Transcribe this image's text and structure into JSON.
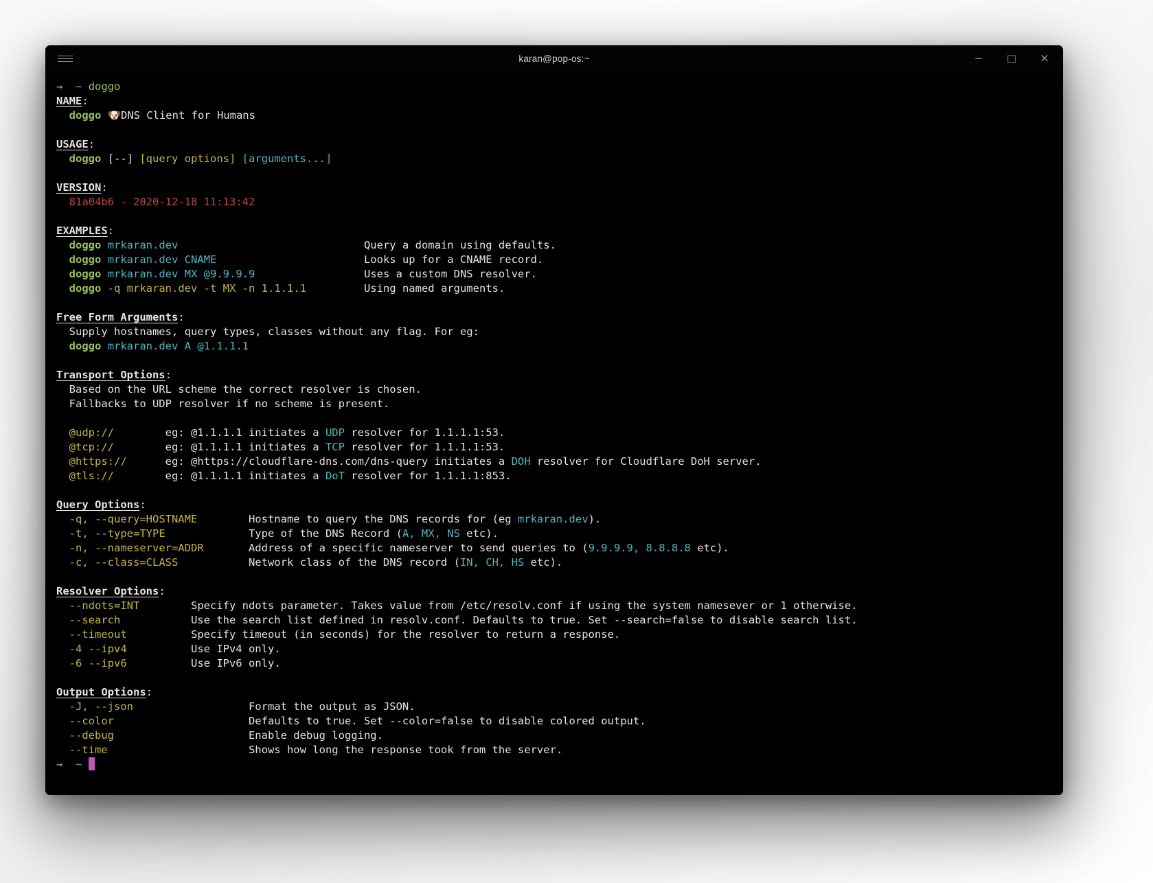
{
  "colors": {
    "page_bg": "#f3f3f3",
    "terminal_bg": "#000000",
    "fg": "#e6e3dd",
    "green": "#98c15e",
    "cyan": "#54b5c1",
    "yellow": "#c3b54a",
    "red": "#bc4b41",
    "magenta": "#c157b8",
    "title_fg": "#d2d0cc",
    "control_fg": "#919191"
  },
  "window": {
    "title": "karan@pop-os:~",
    "controls": {
      "minimize": "−",
      "maximize": "□",
      "close": "×"
    }
  },
  "terminal": {
    "lines": [
      {
        "s": [
          {
            "t": "→",
            "c": "green"
          },
          {
            "t": "  "
          },
          {
            "t": "~",
            "c": "cyan"
          },
          {
            "t": " "
          },
          {
            "t": "doggo",
            "c": "green"
          }
        ]
      },
      {
        "s": [
          {
            "t": "NAME",
            "b": 1,
            "u": 1
          },
          {
            "t": ":"
          }
        ]
      },
      {
        "s": [
          {
            "t": "  "
          },
          {
            "t": "doggo",
            "c": "green",
            "b": 1
          },
          {
            "t": " 🐶"
          },
          {
            "t": "DNS Client for Humans"
          }
        ]
      },
      {
        "s": []
      },
      {
        "s": [
          {
            "t": "USAGE",
            "b": 1,
            "u": 1
          },
          {
            "t": ":"
          }
        ]
      },
      {
        "s": [
          {
            "t": "  "
          },
          {
            "t": "doggo",
            "c": "green",
            "b": 1
          },
          {
            "t": " [--] "
          },
          {
            "t": "[query options]",
            "c": "yellow"
          },
          {
            "t": " "
          },
          {
            "t": "[arguments...]",
            "c": "cyan"
          }
        ]
      },
      {
        "s": []
      },
      {
        "s": [
          {
            "t": "VERSION",
            "b": 1,
            "u": 1
          },
          {
            "t": ":"
          }
        ]
      },
      {
        "s": [
          {
            "t": "  "
          },
          {
            "t": "81a04b6 - 2020-12-18 11:13:42",
            "c": "red"
          }
        ]
      },
      {
        "s": []
      },
      {
        "s": [
          {
            "t": "EXAMPLES",
            "b": 1,
            "u": 1
          },
          {
            "t": ":"
          }
        ]
      },
      {
        "s": [
          {
            "t": "  "
          },
          {
            "t": "doggo",
            "c": "green",
            "b": 1
          },
          {
            "t": " "
          },
          {
            "t": "mrkaran.dev",
            "c": "cyan"
          },
          {
            "t": "                             Query a domain using defaults."
          }
        ]
      },
      {
        "s": [
          {
            "t": "  "
          },
          {
            "t": "doggo",
            "c": "green",
            "b": 1
          },
          {
            "t": " "
          },
          {
            "t": "mrkaran.dev CNAME",
            "c": "cyan"
          },
          {
            "t": "                       Looks up for a CNAME record."
          }
        ]
      },
      {
        "s": [
          {
            "t": "  "
          },
          {
            "t": "doggo",
            "c": "green",
            "b": 1
          },
          {
            "t": " "
          },
          {
            "t": "mrkaran.dev MX @9.9.9.9",
            "c": "cyan"
          },
          {
            "t": "                 Uses a custom DNS resolver."
          }
        ]
      },
      {
        "s": [
          {
            "t": "  "
          },
          {
            "t": "doggo",
            "c": "green",
            "b": 1
          },
          {
            "t": " "
          },
          {
            "t": "-q mrkaran.dev -t MX -n 1.1.1.1",
            "c": "yellow"
          },
          {
            "t": "         Using named arguments."
          }
        ]
      },
      {
        "s": []
      },
      {
        "s": [
          {
            "t": "Free Form Arguments",
            "b": 1,
            "u": 1
          },
          {
            "t": ":"
          }
        ]
      },
      {
        "s": [
          {
            "t": "  Supply hostnames, query types, classes without any flag. For eg:"
          }
        ]
      },
      {
        "s": [
          {
            "t": "  "
          },
          {
            "t": "doggo",
            "c": "green",
            "b": 1
          },
          {
            "t": " "
          },
          {
            "t": "mrkaran.dev A @1.1.1.1",
            "c": "cyan"
          }
        ]
      },
      {
        "s": []
      },
      {
        "s": [
          {
            "t": "Transport Options",
            "b": 1,
            "u": 1
          },
          {
            "t": ":"
          }
        ]
      },
      {
        "s": [
          {
            "t": "  Based on the URL scheme the correct resolver is chosen."
          }
        ]
      },
      {
        "s": [
          {
            "t": "  Fallbacks to UDP resolver if no scheme is present."
          }
        ]
      },
      {
        "s": []
      },
      {
        "s": [
          {
            "t": "  "
          },
          {
            "t": "@udp://",
            "c": "yellow"
          },
          {
            "t": "        eg: @1.1.1.1 initiates a "
          },
          {
            "t": "UDP",
            "c": "cyan"
          },
          {
            "t": " resolver for 1.1.1.1:53."
          }
        ]
      },
      {
        "s": [
          {
            "t": "  "
          },
          {
            "t": "@tcp://",
            "c": "yellow"
          },
          {
            "t": "        eg: @1.1.1.1 initiates a "
          },
          {
            "t": "TCP",
            "c": "cyan"
          },
          {
            "t": " resolver for 1.1.1.1:53."
          }
        ]
      },
      {
        "s": [
          {
            "t": "  "
          },
          {
            "t": "@https://",
            "c": "yellow"
          },
          {
            "t": "      eg: @https://cloudflare-dns.com/dns-query initiates a "
          },
          {
            "t": "DOH",
            "c": "cyan"
          },
          {
            "t": " resolver for Cloudflare DoH server."
          }
        ]
      },
      {
        "s": [
          {
            "t": "  "
          },
          {
            "t": "@tls://",
            "c": "yellow"
          },
          {
            "t": "        eg: @1.1.1.1 initiates a "
          },
          {
            "t": "DoT",
            "c": "cyan"
          },
          {
            "t": " resolver for 1.1.1.1:853."
          }
        ]
      },
      {
        "s": []
      },
      {
        "s": [
          {
            "t": "Query Options",
            "b": 1,
            "u": 1
          },
          {
            "t": ":"
          }
        ]
      },
      {
        "s": [
          {
            "t": "  "
          },
          {
            "t": "-q, --query=HOSTNAME",
            "c": "yellow"
          },
          {
            "t": "        Hostname to query the DNS records for (eg "
          },
          {
            "t": "mrkaran.dev",
            "c": "cyan"
          },
          {
            "t": ")."
          }
        ]
      },
      {
        "s": [
          {
            "t": "  "
          },
          {
            "t": "-t, --type=TYPE",
            "c": "yellow"
          },
          {
            "t": "             Type of the DNS Record ("
          },
          {
            "t": "A, MX, NS",
            "c": "cyan"
          },
          {
            "t": " etc)."
          }
        ]
      },
      {
        "s": [
          {
            "t": "  "
          },
          {
            "t": "-n, --nameserver=ADDR",
            "c": "yellow"
          },
          {
            "t": "       Address of a specific nameserver to send queries to ("
          },
          {
            "t": "9.9.9.9, 8.8.8.8",
            "c": "cyan"
          },
          {
            "t": " etc)."
          }
        ]
      },
      {
        "s": [
          {
            "t": "  "
          },
          {
            "t": "-c, --class=CLASS",
            "c": "yellow"
          },
          {
            "t": "           Network class of the DNS record ("
          },
          {
            "t": "IN, CH, HS",
            "c": "cyan"
          },
          {
            "t": " etc)."
          }
        ]
      },
      {
        "s": []
      },
      {
        "s": [
          {
            "t": "Resolver Options",
            "b": 1,
            "u": 1
          },
          {
            "t": ":"
          }
        ]
      },
      {
        "s": [
          {
            "t": "  "
          },
          {
            "t": "--ndots=INT",
            "c": "yellow"
          },
          {
            "t": "        Specify ndots parameter. Takes value from /etc/resolv.conf if using the system namesever or 1 otherwise."
          }
        ]
      },
      {
        "s": [
          {
            "t": "  "
          },
          {
            "t": "--search",
            "c": "yellow"
          },
          {
            "t": "           Use the search list defined in resolv.conf. Defaults to true. Set --search=false to disable search list."
          }
        ]
      },
      {
        "s": [
          {
            "t": "  "
          },
          {
            "t": "--timeout",
            "c": "yellow"
          },
          {
            "t": "          Specify timeout (in seconds) for the resolver to return a response."
          }
        ]
      },
      {
        "s": [
          {
            "t": "  "
          },
          {
            "t": "-4 --ipv4",
            "c": "yellow"
          },
          {
            "t": "          Use IPv4 only."
          }
        ]
      },
      {
        "s": [
          {
            "t": "  "
          },
          {
            "t": "-6 --ipv6",
            "c": "yellow"
          },
          {
            "t": "          Use IPv6 only."
          }
        ]
      },
      {
        "s": []
      },
      {
        "s": [
          {
            "t": "Output Options",
            "b": 1,
            "u": 1
          },
          {
            "t": ":"
          }
        ]
      },
      {
        "s": [
          {
            "t": "  "
          },
          {
            "t": "-J, --json",
            "c": "yellow"
          },
          {
            "t": "                  Format the output as JSON."
          }
        ]
      },
      {
        "s": [
          {
            "t": "  "
          },
          {
            "t": "--color",
            "c": "yellow"
          },
          {
            "t": "                     Defaults to true. Set --color=false to disable colored output."
          }
        ]
      },
      {
        "s": [
          {
            "t": "  "
          },
          {
            "t": "--debug",
            "c": "yellow"
          },
          {
            "t": "                     Enable debug logging."
          }
        ]
      },
      {
        "s": [
          {
            "t": "  "
          },
          {
            "t": "--time",
            "c": "yellow"
          },
          {
            "t": "                      Shows how long the response took from the server."
          }
        ]
      },
      {
        "s": [
          {
            "t": "→",
            "c": "green"
          },
          {
            "t": "  "
          },
          {
            "t": "~",
            "c": "cyan"
          },
          {
            "t": " "
          },
          {
            "t": " ",
            "cursor": 1
          }
        ]
      }
    ]
  }
}
